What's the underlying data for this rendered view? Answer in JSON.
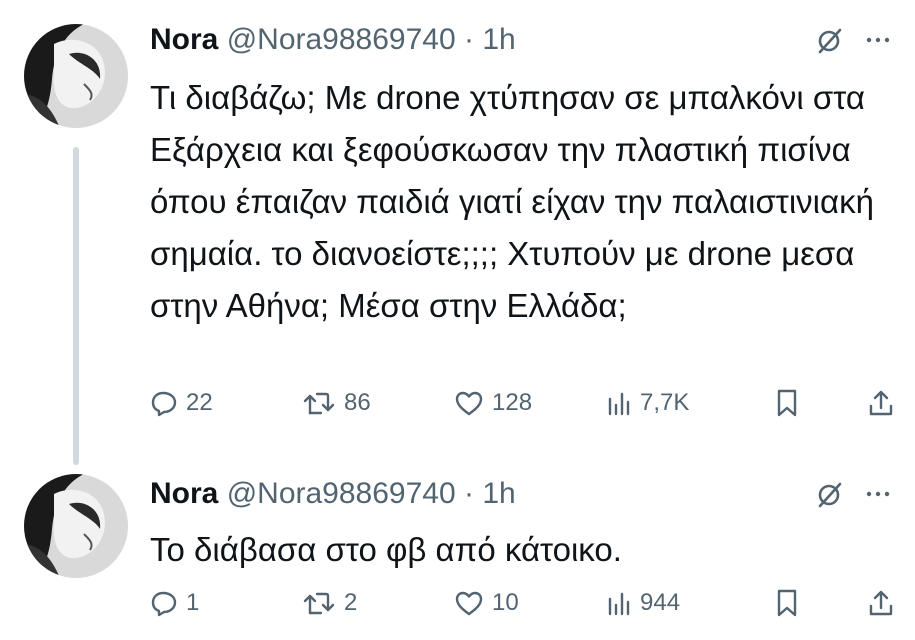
{
  "tweets": [
    {
      "name": "Nora",
      "handle": "@Nora98869740",
      "time": "· 1h",
      "text": "Τι διαβάζω; Με drone χτύπησαν σε μπαλκόνι στα Εξάρχεια και ξεφούσκωσαν την πλαστική πισίνα όπου έπαιζαν παιδιά γιατί είχαν την παλαιστινιακή σημαία. το διανοείστε;;;; Χτυπούν με drone μεσα στην Αθήνα; Μέσα στην Ελλάδα;",
      "replies": "22",
      "retweets": "86",
      "likes": "128",
      "views": "7,7K"
    },
    {
      "name": "Nora",
      "handle": "@Nora98869740",
      "time": "· 1h",
      "text": "Το διάβασα στο φβ από κάτοικο.",
      "replies": "1",
      "retweets": "2",
      "likes": "10",
      "views": "944"
    }
  ],
  "icons": {
    "header": [
      "grok-icon",
      "more-icon"
    ],
    "actions": [
      "reply-icon",
      "retweet-icon",
      "like-icon",
      "views-icon",
      "bookmark-icon",
      "share-icon"
    ]
  },
  "colors": {
    "text": "#0f1419",
    "muted": "#536471",
    "thread_line": "#cfd9de"
  }
}
